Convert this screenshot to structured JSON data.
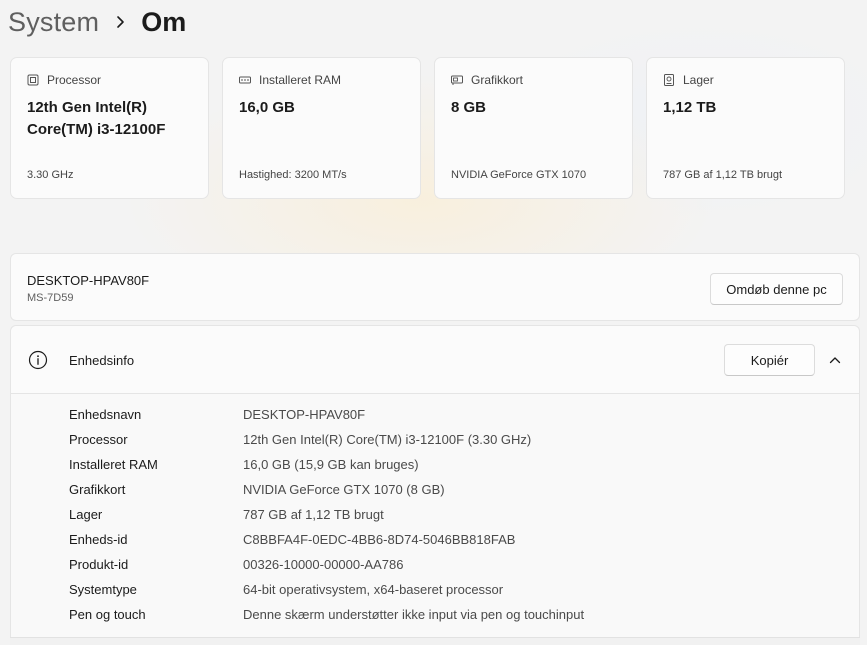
{
  "breadcrumb": {
    "parent": "System",
    "current": "Om"
  },
  "cards": [
    {
      "icon": "processor-icon",
      "label": "Processor",
      "value": "12th Gen Intel(R) Core(TM) i3-12100F",
      "footer": "3.30 GHz"
    },
    {
      "icon": "ram-icon",
      "label": "Installeret RAM",
      "value": "16,0 GB",
      "footer": "Hastighed: 3200 MT/s"
    },
    {
      "icon": "graphics-card-icon",
      "label": "Grafikkort",
      "value": "8 GB",
      "footer": "NVIDIA GeForce GTX 1070"
    },
    {
      "icon": "storage-icon",
      "label": "Lager",
      "value": "1,12 TB",
      "footer": "787 GB af 1,12 TB brugt"
    }
  ],
  "device": {
    "name": "DESKTOP-HPAV80F",
    "model": "MS-7D59",
    "rename_label": "Omdøb denne pc"
  },
  "device_info": {
    "title": "Enhedsinfo",
    "copy_label": "Kopiér",
    "expanded": true,
    "rows": [
      {
        "label": "Enhedsnavn",
        "value": "DESKTOP-HPAV80F"
      },
      {
        "label": "Processor",
        "value": "12th Gen Intel(R) Core(TM) i3-12100F (3.30 GHz)"
      },
      {
        "label": "Installeret RAM",
        "value": "16,0 GB (15,9 GB kan bruges)"
      },
      {
        "label": "Grafikkort",
        "value": "NVIDIA GeForce GTX 1070 (8 GB)"
      },
      {
        "label": "Lager",
        "value": "787 GB af 1,12 TB brugt"
      },
      {
        "label": "Enheds-id",
        "value": "C8BBFA4F-0EDC-4BB6-8D74-5046BB818FAB"
      },
      {
        "label": "Produkt-id",
        "value": "00326-10000-00000-AA786"
      },
      {
        "label": "Systemtype",
        "value": "64-bit operativsystem, x64-baseret processor"
      },
      {
        "label": "Pen og touch",
        "value": "Denne skærm understøtter ikke input via pen og touchinput"
      }
    ]
  },
  "colors": {
    "window_bg": "#f3f3f3",
    "card_bg": "#fbfbfb",
    "border": "#e5e5e5",
    "text": "#1b1b1b",
    "secondary_text": "#5f5f5f"
  }
}
